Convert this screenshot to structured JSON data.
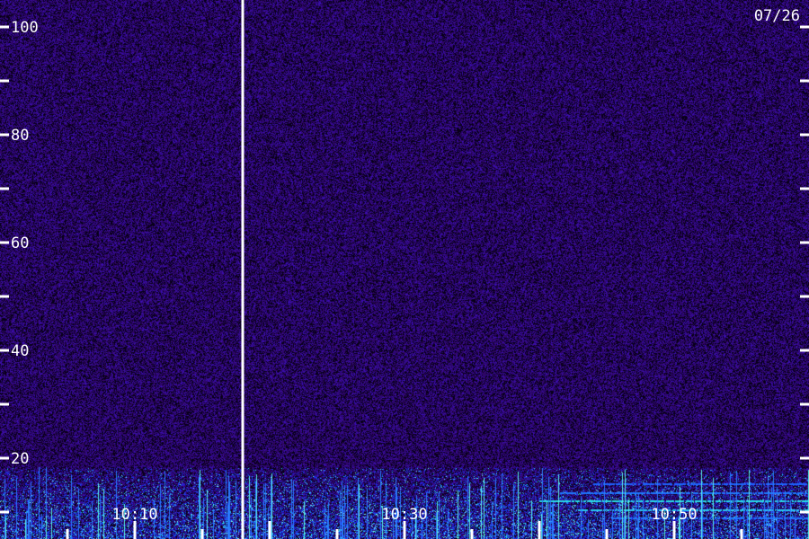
{
  "date_label": "07/26",
  "chart_data": {
    "type": "heatmap",
    "title": "",
    "xlabel": "",
    "ylabel": "",
    "ylim": [
      15,
      105
    ],
    "x_ticks": [
      "10:10",
      "10:30",
      "10:50"
    ],
    "y_ticks": [
      "100",
      "80",
      "60",
      "40",
      "20"
    ],
    "y_minor_ticks": [
      90,
      70,
      50,
      30,
      15
    ],
    "grid": false,
    "marker_time": "10:17",
    "colors": {
      "background": "#2a0a6e",
      "low": "#1b1aa8",
      "mid": "#2a6cff",
      "high": "#36f0e0",
      "marker": "#ffffff"
    },
    "noise_floor_below": 20
  }
}
